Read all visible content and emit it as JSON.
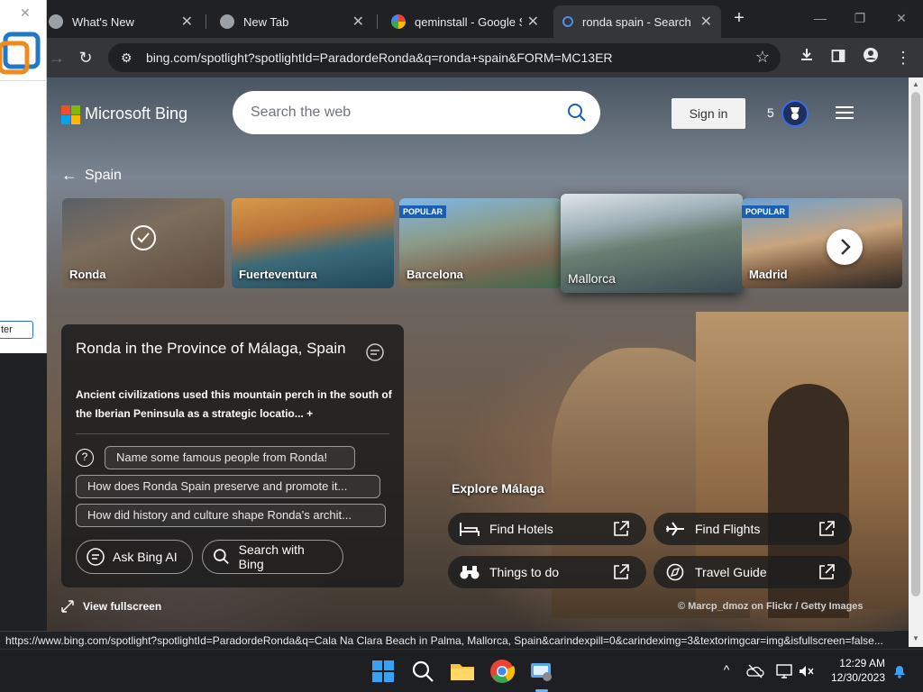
{
  "browser": {
    "tabs": [
      {
        "label": "What's New",
        "active": false
      },
      {
        "label": "New Tab",
        "active": false
      },
      {
        "label": "qeminstall - Google Se",
        "active": false
      },
      {
        "label": "ronda spain - Search",
        "active": true
      }
    ],
    "url": "bing.com/spotlight?spotlightId=ParadordeRonda&q=ronda+spain&FORM=MC13ER",
    "status_url": "https://www.bing.com/spotlight?spotlightId=ParadordeRonda&q=Cala Na Clara Beach in Palma, Mallorca, Spain&carindexpill=0&carindeximg=3&textorimgcar=img&isfullscreen=false..."
  },
  "side_window": {
    "button_label": "ter"
  },
  "bing": {
    "logo_text": "Microsoft Bing",
    "search_placeholder": "Search the web",
    "signin_label": "Sign in",
    "points": "5",
    "brand_colors": [
      "#f25022",
      "#7fba00",
      "#00a4ef",
      "#ffb900"
    ]
  },
  "spotlight": {
    "back_label": "Spain",
    "cards": [
      {
        "label": "Ronda",
        "popular": false,
        "selected": true
      },
      {
        "label": "Fuerteventura",
        "popular": false,
        "selected": false
      },
      {
        "label": "Barcelona",
        "popular": true,
        "selected": false
      },
      {
        "label": "Mallorca",
        "popular": false,
        "selected": false
      },
      {
        "label": "Madrid",
        "popular": true,
        "selected": false
      }
    ],
    "popular_badge": "POPULAR",
    "info": {
      "title": "Ronda in the Province of Málaga, Spain",
      "description": "Ancient civilizations used this mountain perch in the south of the Iberian Peninsula as a strategic locatio...",
      "more_symbol": "+",
      "questions": [
        "Name some famous people from Ronda!",
        "How does Ronda Spain preserve and promote it...",
        "How did history and culture shape Ronda's archit..."
      ],
      "ask_label": "Ask Bing AI",
      "search_label": "Search with Bing"
    },
    "fullscreen_label": "View fullscreen",
    "explore": {
      "heading": "Explore Málaga",
      "links": [
        {
          "label": "Find Hotels",
          "icon": "bed-icon"
        },
        {
          "label": "Find Flights",
          "icon": "plane-icon"
        },
        {
          "label": "Things to do",
          "icon": "binoculars-icon"
        },
        {
          "label": "Travel Guide",
          "icon": "compass-icon"
        }
      ]
    },
    "credit": "© Marcp_dmoz on Flickr / Getty Images"
  },
  "taskbar": {
    "time": "12:29 AM",
    "date": "12/30/2023"
  }
}
